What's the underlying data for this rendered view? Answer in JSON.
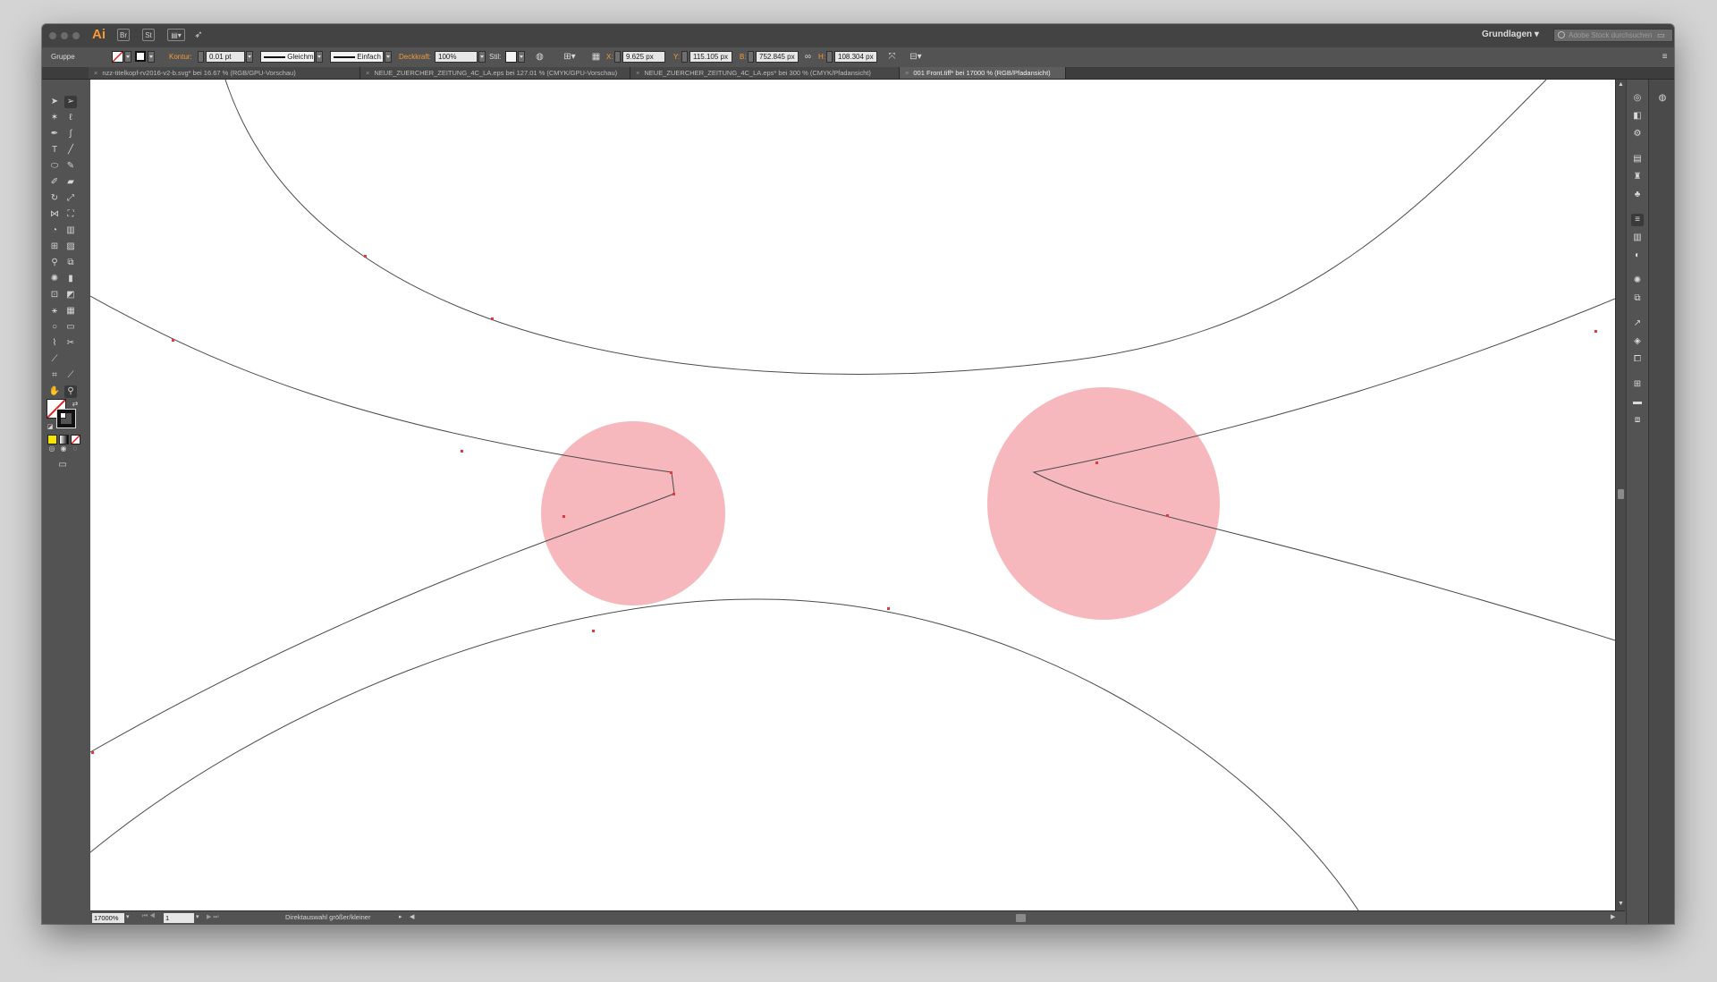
{
  "app": {
    "logo": "Ai",
    "bridge_btn": "Br",
    "stock_btn": "St",
    "workspace": "Grundlagen",
    "stock_search_placeholder": "Adobe Stock durchsuchen"
  },
  "controlbar": {
    "selection_type": "Gruppe",
    "stroke_label": "Kontur:",
    "stroke_weight": "0.01 pt",
    "profile_label": "Gleichm.",
    "brush_label": "Einfach",
    "opacity_label": "Deckkraft:",
    "opacity_value": "100%",
    "style_label": "Stil:",
    "x_label": "X:",
    "x_value": "9.625 px",
    "y_label": "Y:",
    "y_value": "115.105 px",
    "w_label": "B:",
    "w_value": "752.845 px",
    "h_label": "H:",
    "h_value": "108.304 px"
  },
  "tabs": [
    {
      "label": "nzz-titelkopf-rv2016-v2-b.svg* bei 16.67 % (RGB/GPU-Vorschau)",
      "active": false
    },
    {
      "label": "NEUE_ZUERCHER_ZEITUNG_4C_LA.eps bei 127.01 % (CMYK/GPU-Vorschau)",
      "active": false
    },
    {
      "label": "NEUE_ZUERCHER_ZEITUNG_4C_LA.eps* bei 300 % (CMYK/Pfadansicht)",
      "active": false
    },
    {
      "label": "001 Front.tiff* bei 17000 % (RGB/Pfadansicht)",
      "active": true
    }
  ],
  "statusbar": {
    "zoom": "17000%",
    "artboard": "1",
    "tool_hint": "Direktauswahl größer/kleiner"
  },
  "colors": {
    "highlight_circle": "#f7b8bd",
    "anchor_point": "#e23a3a",
    "path_stroke": "#4a4a4a",
    "canvas": "#ffffff",
    "chrome": "#535353"
  },
  "icons": {
    "close_tab": "×",
    "link": "∞"
  }
}
